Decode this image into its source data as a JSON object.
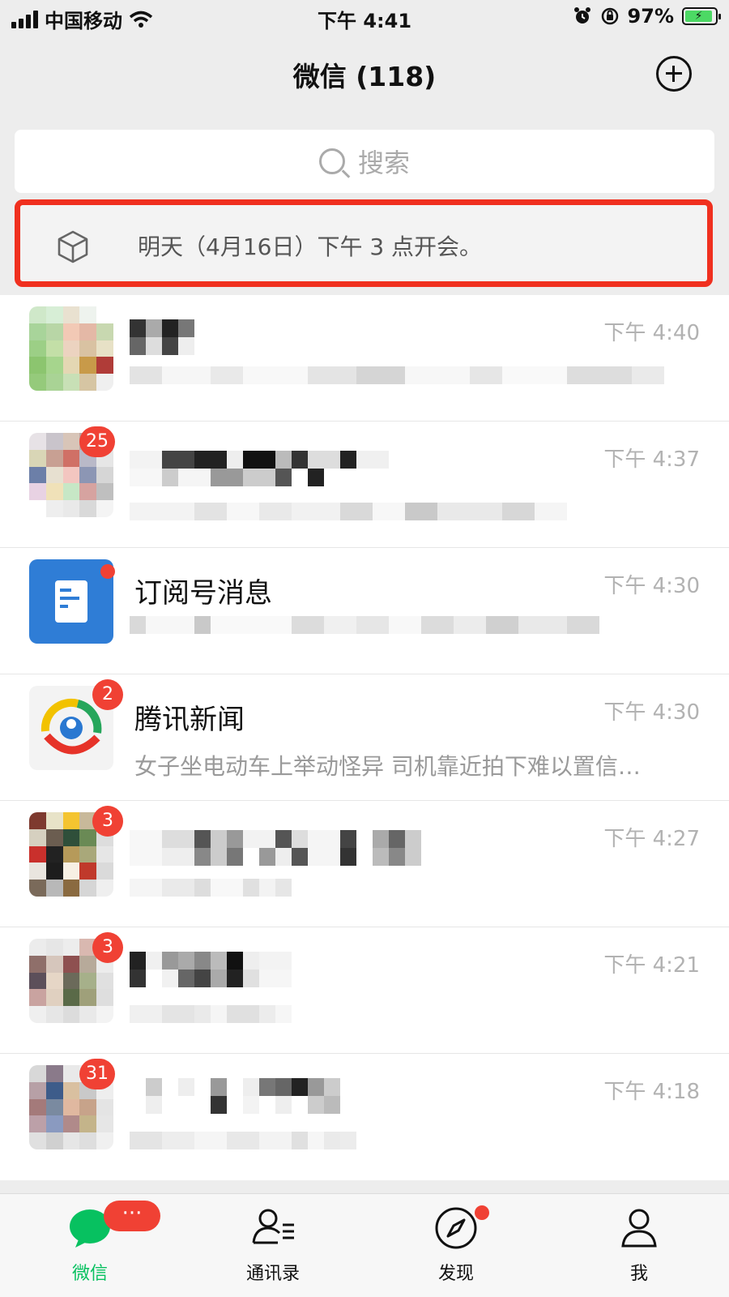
{
  "status_bar": {
    "carrier": "中国移动",
    "time": "下午 4:41",
    "battery_percent": "97%"
  },
  "header": {
    "title": "微信 (118)",
    "add_icon": "plus-circle-icon"
  },
  "search": {
    "placeholder": "搜索"
  },
  "reminder": {
    "text": "明天（4月16日）下午 3 点开会。",
    "icon": "cube-icon",
    "highlight_color": "#f0301f"
  },
  "chats": [
    {
      "name": "",
      "time": "下午 4:40",
      "preview": "",
      "badge": ""
    },
    {
      "name": "",
      "time": "下午 4:37",
      "preview": "",
      "badge": "25"
    },
    {
      "name": "订阅号消息",
      "time": "下午 4:30",
      "preview": "",
      "badge": "",
      "dot": true
    },
    {
      "name": "腾讯新闻",
      "time": "下午 4:30",
      "preview": "女子坐电动车上举动怪异 司机靠近拍下难以置信…",
      "badge": "2"
    },
    {
      "name": "",
      "time": "下午 4:27",
      "preview": "",
      "badge": "3"
    },
    {
      "name": "",
      "time": "下午 4:21",
      "preview": "",
      "badge": "3"
    },
    {
      "name": "",
      "time": "下午 4:18",
      "preview": "",
      "badge": "31"
    }
  ],
  "tabbar": {
    "tabs": [
      {
        "label": "微信",
        "icon": "chat-bubble-icon",
        "active": true
      },
      {
        "label": "通讯录",
        "icon": "contacts-icon"
      },
      {
        "label": "发现",
        "icon": "compass-icon"
      },
      {
        "label": "我",
        "icon": "person-icon"
      }
    ],
    "chat_badge": "···"
  },
  "colors": {
    "accent_green": "#07c160",
    "badge_red": "#f04134"
  }
}
